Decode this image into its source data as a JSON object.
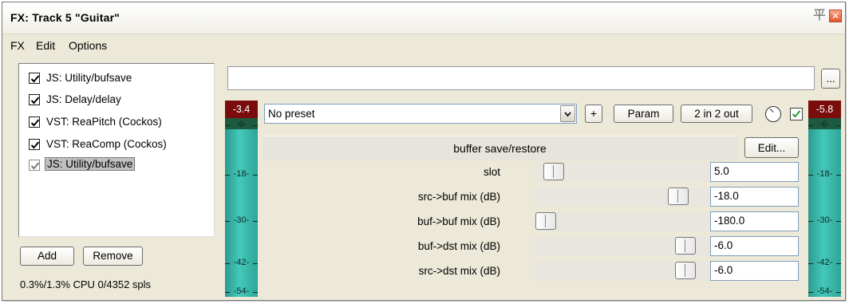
{
  "window": {
    "title": "FX: Track 5 \"Guitar\"",
    "pin_icon": "平",
    "close_icon": "✕"
  },
  "menu": [
    "FX",
    "Edit",
    "Options"
  ],
  "fx_chain": [
    {
      "label": "JS: Utility/bufsave",
      "enabled": true,
      "selected": false
    },
    {
      "label": "JS: Delay/delay",
      "enabled": true,
      "selected": false
    },
    {
      "label": "VST: ReaPitch (Cockos)",
      "enabled": true,
      "selected": false
    },
    {
      "label": "VST: ReaComp (Cockos)",
      "enabled": true,
      "selected": false
    },
    {
      "label": "JS: Utility/bufsave",
      "enabled": true,
      "selected": true
    }
  ],
  "buttons": {
    "add": "Add",
    "remove": "Remove",
    "browse": "...",
    "plus": "+",
    "param": "Param",
    "routing": "2 in 2 out",
    "edit": "Edit..."
  },
  "cpu_status": "0.3%/1.3% CPU 0/4352 spls",
  "meters": {
    "input": {
      "peak": "-3.4",
      "ticks": [
        "-6-",
        "-18-",
        "-30-",
        "-42-",
        "-54-"
      ]
    },
    "output": {
      "peak": "-5.8",
      "ticks": [
        "-6-",
        "-18-",
        "-30-",
        "-42-",
        "-54-"
      ]
    }
  },
  "preset": {
    "selected": "No preset"
  },
  "plugin": {
    "name": "buffer save/restore"
  },
  "params": [
    {
      "label": "slot",
      "value": "5.0"
    },
    {
      "label": "src->buf mix (dB)",
      "value": "-18.0"
    },
    {
      "label": "buf->buf mix (dB)",
      "value": "-180.0"
    },
    {
      "label": "buf->dst mix (dB)",
      "value": "-6.0"
    },
    {
      "label": "src->dst mix (dB)",
      "value": "-6.0"
    }
  ],
  "colors": {
    "meter": "#43c9ba",
    "peak": "#7a0c0c",
    "check": "#2a9d2a"
  }
}
